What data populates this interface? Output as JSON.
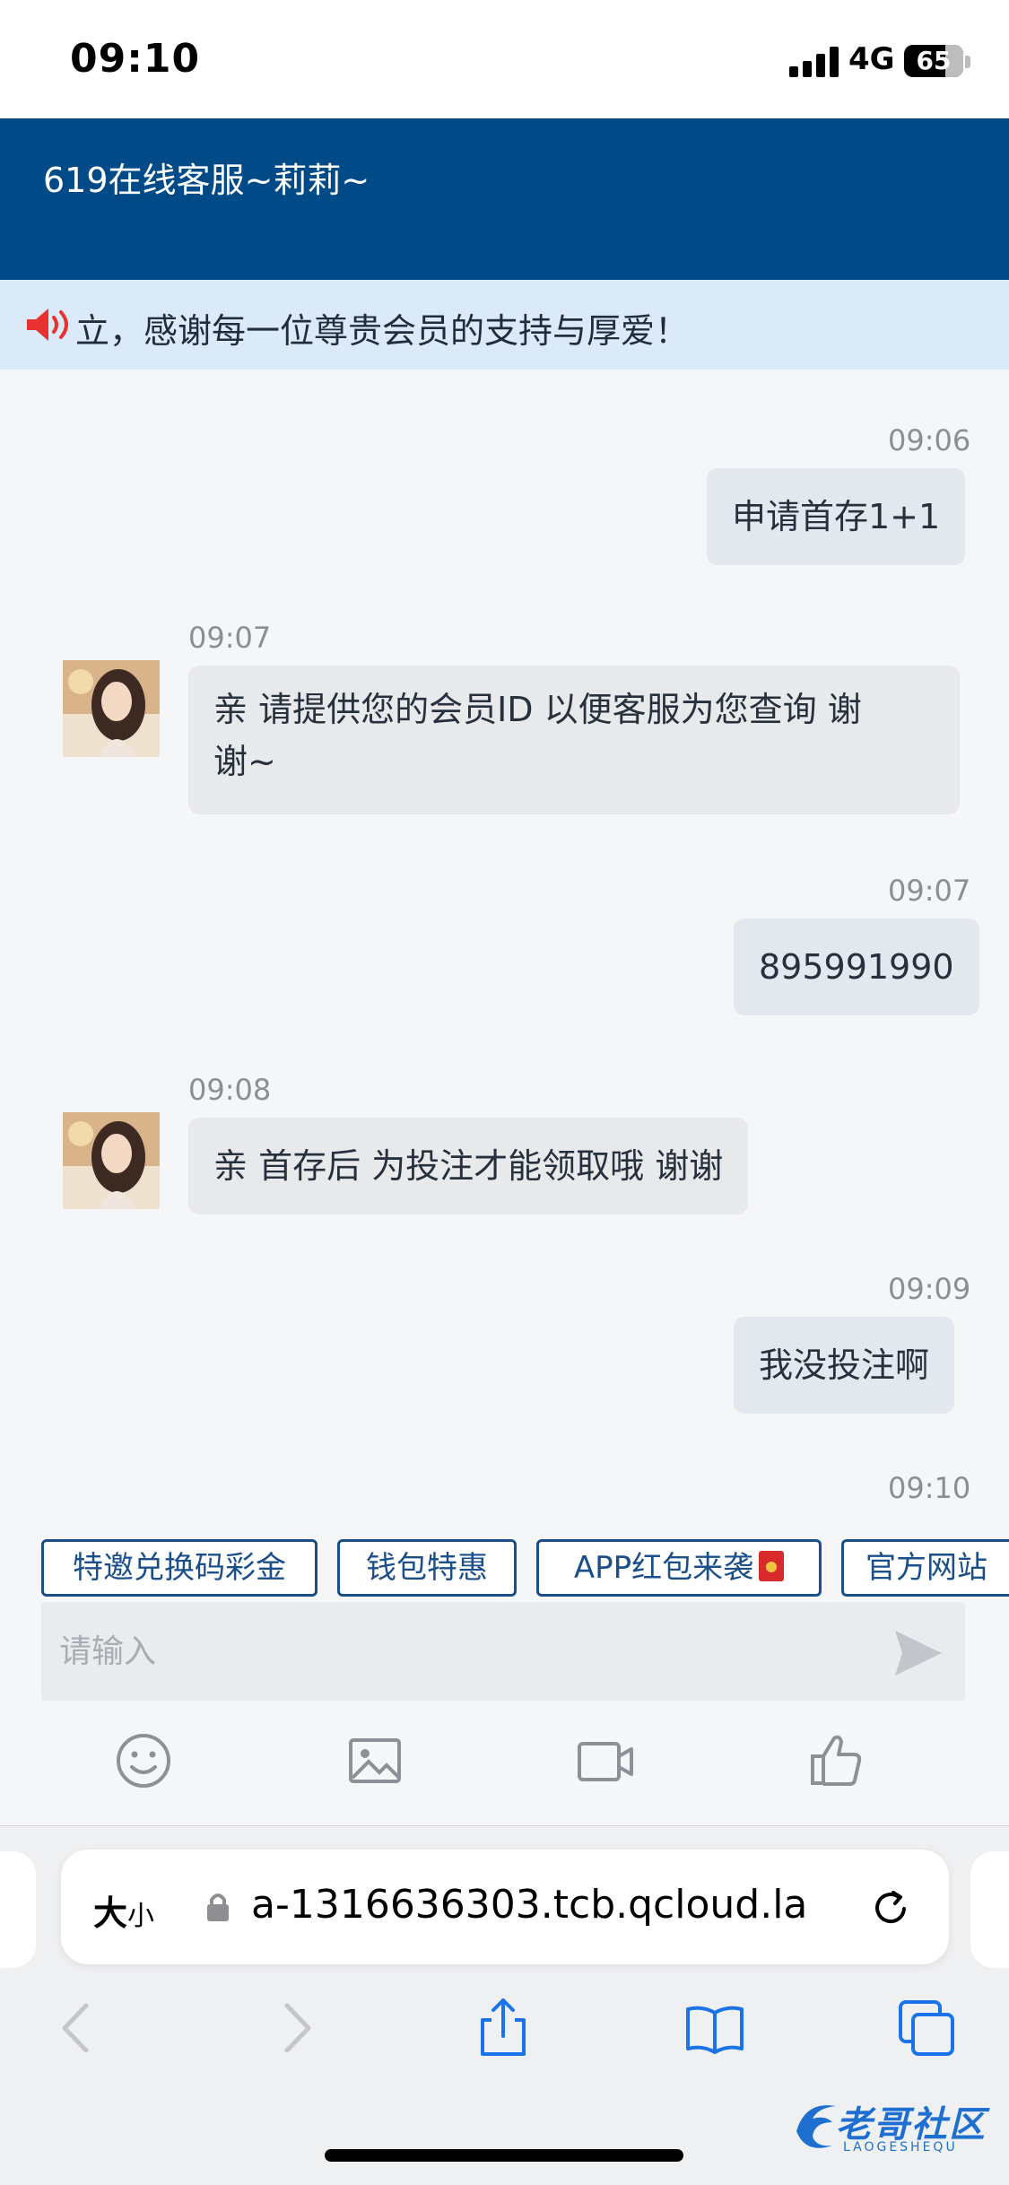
{
  "status_bar": {
    "time": "09:10",
    "network": "4G",
    "battery": "65"
  },
  "header": {
    "title": "619在线客服~莉莉~"
  },
  "notice": {
    "text": "立，感谢每一位尊贵会员的支持与厚爱！"
  },
  "messages": [
    {
      "dir": "out",
      "time": "09:06",
      "text": "申请首存1+1"
    },
    {
      "dir": "in",
      "time": "09:07",
      "text_line1": "亲 请提供您的会员ID 以便客服为您查询 谢",
      "text_line2": "谢~"
    },
    {
      "dir": "out",
      "time": "09:07",
      "text": "895991990"
    },
    {
      "dir": "in",
      "time": "09:08",
      "text": "亲 首存后 为投注才能领取哦 谢谢"
    },
    {
      "dir": "out",
      "time": "09:09",
      "text": "我没投注啊"
    },
    {
      "dir": "out",
      "time": "09:10",
      "text": ""
    }
  ],
  "quick_buttons": [
    "特邀兑换码彩金",
    "钱包特惠",
    "APP红包来袭",
    "官方网站"
  ],
  "input": {
    "placeholder": "请输入",
    "value": ""
  },
  "toolbar": [
    "emoji-icon",
    "image-icon",
    "video-icon",
    "thumbs-up-icon"
  ],
  "safari": {
    "text_size_label": "大",
    "text_size_small": "小",
    "url": "a-1316636303.tcb.qcloud.la"
  },
  "watermark": {
    "text": "老哥社区",
    "sub": "LAOGESHEQU"
  },
  "colors": {
    "header": "#004a88",
    "notice_bg": "#dbeaf8",
    "accent": "#1b4f8c",
    "speaker": "#e8322f"
  }
}
